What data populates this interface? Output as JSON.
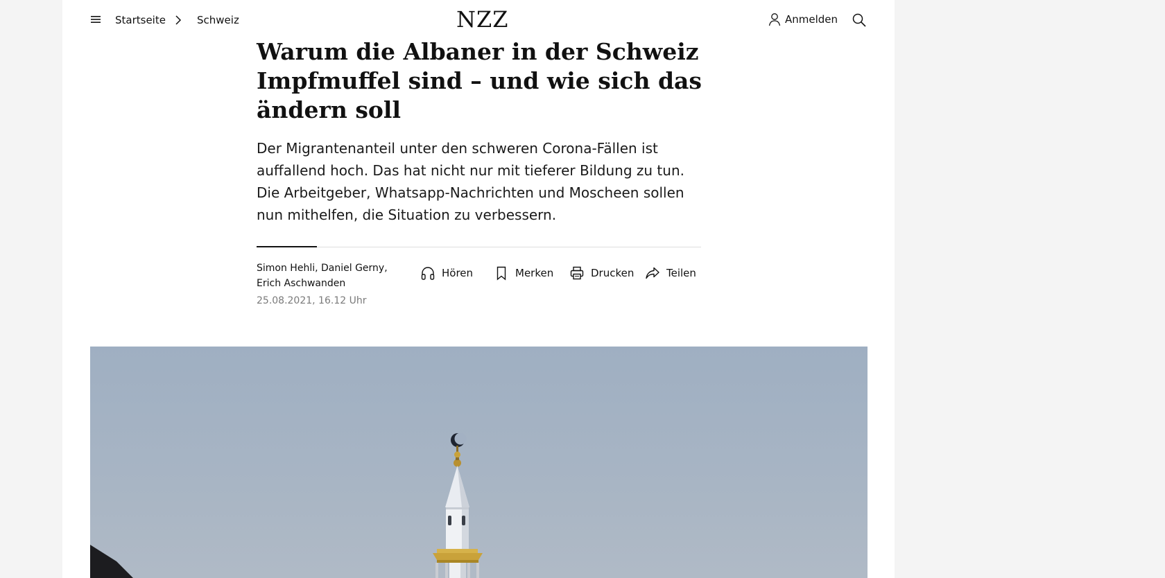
{
  "header": {
    "breadcrumb": {
      "home": "Startseite",
      "current": "Schweiz"
    },
    "logo": "NZZ",
    "login_label": "Anmelden",
    "icons": {
      "menu": "hamburger-menu-icon",
      "separator": "chevron-right-icon",
      "user": "user-icon",
      "search": "search-icon"
    }
  },
  "article": {
    "headline": "Warum die Albaner in der Schweiz Impfmuffel sind – und wie sich das ändern soll",
    "lead": "Der Migrantenanteil unter den schweren Corona-Fällen ist auffallend hoch. Das hat nicht nur mit tieferer Bildung zu tun. Die Arbeitgeber, Whatsapp-Nachrichten und Moscheen sollen nun mithelfen, die Situation zu verbessern.",
    "authors": "Simon Hehli, Daniel Gerny, Erich Aschwanden",
    "date": "25.08.2021, 16.12 Uhr",
    "actions": [
      {
        "label": "Hören",
        "icon": "headphones-icon"
      },
      {
        "label": "Merken",
        "icon": "bookmark-icon"
      },
      {
        "label": "Drucken",
        "icon": "printer-icon"
      },
      {
        "label": "Teilen",
        "icon": "share-icon"
      }
    ]
  },
  "hero_image": {
    "subject": "minaret-with-crescent"
  },
  "colors": {
    "page_background": "#f4f4f4",
    "content_background": "#ffffff",
    "text": "#111111",
    "muted_text": "#7a7a7a",
    "sky": "#a8b5c4",
    "gold": "#c9a23a"
  }
}
